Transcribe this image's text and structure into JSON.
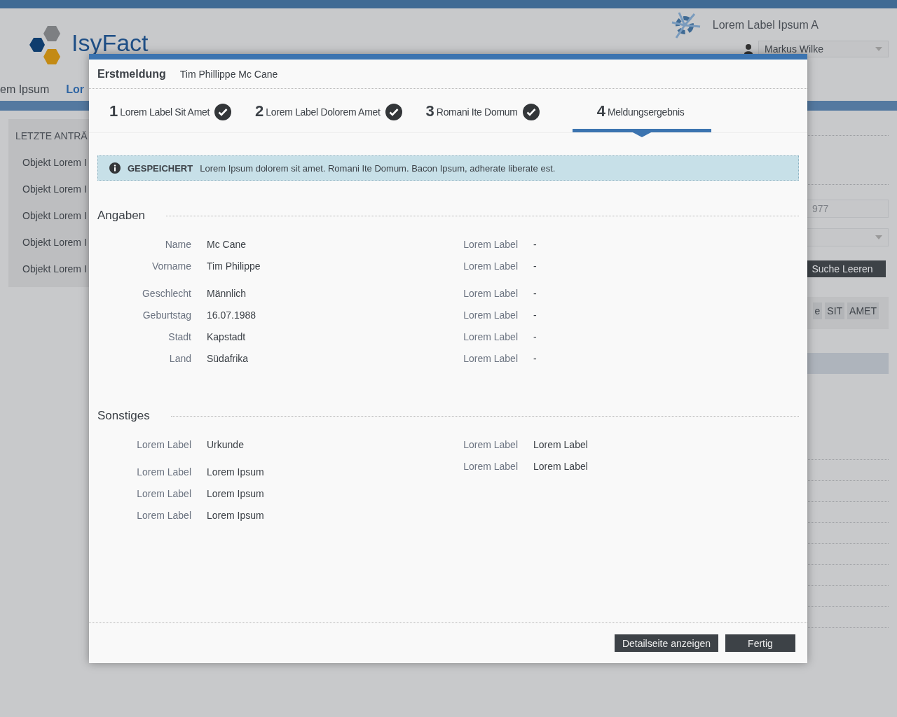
{
  "background": {
    "logo_text": "IsyFact",
    "app_name": "Lorem Label Ipsum A",
    "user": "Markus Wilke",
    "nav": [
      {
        "label": "em Ipsum",
        "selected": false
      },
      {
        "label": "Lor",
        "selected": true
      }
    ],
    "sidebar": {
      "title": "LETZTE ANTRÄ",
      "items": [
        "Objekt Lorem I",
        "Objekt Lorem I",
        "Objekt Lorem I",
        "Objekt Lorem I",
        "Objekt Lorem I"
      ]
    },
    "search_field": {
      "placeholder": "977"
    },
    "clear_button": "Suche Leeren",
    "table_headers": [
      "e",
      "SIT",
      "AMET"
    ]
  },
  "dialog": {
    "title": "Erstmeldung",
    "subtitle": "Tim Phillippe Mc Cane",
    "steps": [
      {
        "number": "1",
        "label": "Lorem Label Sit Amet",
        "done": true,
        "selected": false
      },
      {
        "number": "2",
        "label": "Lorem Label Dolorem Amet",
        "done": true,
        "selected": false
      },
      {
        "number": "3",
        "label": "Romani Ite Domum",
        "done": true,
        "selected": false
      },
      {
        "number": "4",
        "label": "Meldungsergebnis",
        "done": false,
        "selected": true
      }
    ],
    "alert": {
      "title": "GESPEICHERT",
      "text": "Lorem Ipsum dolorem sit amet. Romani Ite Domum. Bacon Ipsum, adherate liberate est."
    },
    "sections": [
      {
        "title": "Angaben",
        "columns": [
          {
            "groups": [
              [
                {
                  "label": "Name",
                  "value": "Mc Cane"
                },
                {
                  "label": "Vorname",
                  "value": "Tim Philippe"
                }
              ],
              [
                {
                  "label": "Geschlecht",
                  "value": "Männlich"
                },
                {
                  "label": "Geburtstag",
                  "value": "16.07.1988"
                },
                {
                  "label": "Stadt",
                  "value": "Kapstadt"
                },
                {
                  "label": "Land",
                  "value": "Südafrika"
                }
              ]
            ]
          },
          {
            "groups": [
              [
                {
                  "label": "Lorem Label",
                  "value": "-"
                },
                {
                  "label": "Lorem Label",
                  "value": "-"
                }
              ],
              [
                {
                  "label": "Lorem Label",
                  "value": "-"
                },
                {
                  "label": "Lorem Label",
                  "value": "-"
                },
                {
                  "label": "Lorem Label",
                  "value": "-"
                },
                {
                  "label": "Lorem Label",
                  "value": "-"
                }
              ]
            ]
          }
        ]
      },
      {
        "title": "Sonstiges",
        "columns": [
          {
            "groups": [
              [
                {
                  "label": "Lorem Label",
                  "value": "Urkunde"
                }
              ],
              [
                {
                  "label": "Lorem Label",
                  "value": "Lorem Ipsum"
                },
                {
                  "label": "Lorem Label",
                  "value": "Lorem Ipsum"
                },
                {
                  "label": "Lorem Label",
                  "value": "Lorem Ipsum"
                }
              ]
            ]
          },
          {
            "groups": [
              [
                {
                  "label": "Lorem Label",
                  "value": "Lorem Label"
                },
                {
                  "label": "Lorem Label",
                  "value": "Lorem Label"
                }
              ]
            ]
          }
        ]
      }
    ],
    "buttons": [
      "Detailseite anzeigen",
      "Fertig"
    ]
  }
}
